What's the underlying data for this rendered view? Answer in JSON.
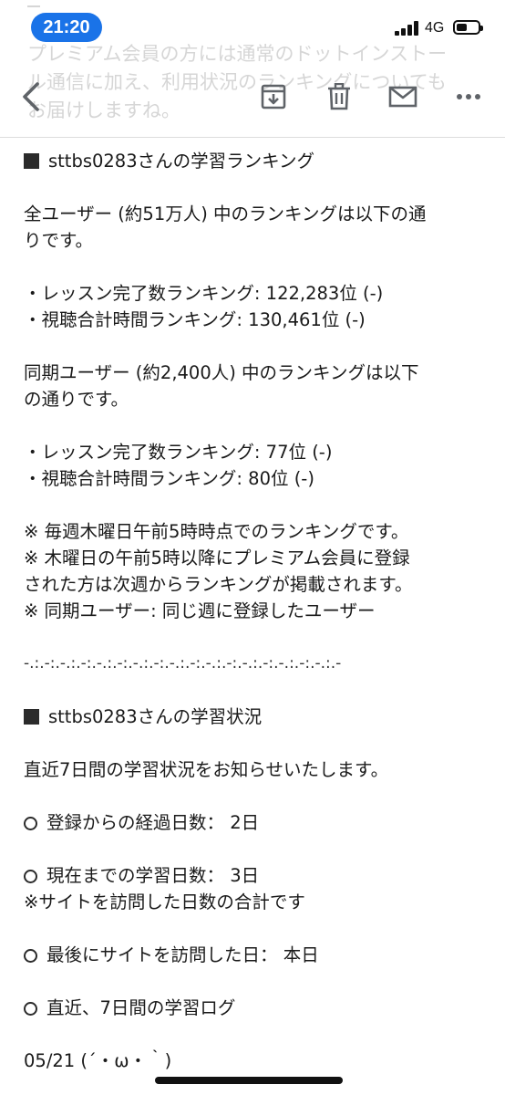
{
  "status_bar": {
    "time": "21:20",
    "network": "4G"
  },
  "background_preview": {
    "line1": "プレミアム会員の方には通常のドットインストー",
    "line2": "ル通信に加え、利用状況のランキングについても",
    "line3": "お届けしますね。"
  },
  "toolbar": {
    "back_icon": "chevron-left-icon",
    "archive_icon": "archive-icon",
    "delete_icon": "trash-icon",
    "mail_icon": "mail-icon",
    "more_icon": "more-horizontal-icon"
  },
  "email": {
    "ranking": {
      "heading": "sttbs0283さんの学習ランキング",
      "all_intro_1": "全ユーザー (約51万人) 中のランキングは以下の通",
      "all_intro_2": "りです。",
      "all_lesson": "・レッスン完了数ランキング: 122,283位 (-)",
      "all_time": "・視聴合計時間ランキング: 130,461位 (-)",
      "cohort_intro_1": "同期ユーザー (約2,400人) 中のランキングは以下",
      "cohort_intro_2": "の通りです。",
      "cohort_lesson": "・レッスン完了数ランキング: 77位 (-)",
      "cohort_time": "・視聴合計時間ランキング: 80位 (-)",
      "note1": "※ 毎週木曜日午前5時時点でのランキングです。",
      "note2a": "※ 木曜日の午前5時以降にプレミアム会員に登録",
      "note2b": "された方は次週からランキングが掲載されます。",
      "note3": "※ 同期ユーザー: 同じ週に登録したユーザー"
    },
    "divider": "-.:.-:.-.:.-:.-.:.-:.-.:.-:.-.:.-:.-.:.-:.-.:.-:.-.:.-:.-.:.-",
    "status": {
      "heading": "sttbs0283さんの学習状況",
      "intro": "直近7日間の学習状況をお知らせいたします。",
      "elapsed": "登録からの経過日数： 2日",
      "study_days": "現在までの学習日数： 3日",
      "study_days_note": "※サイトを訪問した日数の合計です",
      "last_visit": "最後にサイトを訪問した日： 本日",
      "log_heading": "直近、7日間の学習ログ",
      "log_first": "05/21 (´・ω・｀)"
    }
  }
}
